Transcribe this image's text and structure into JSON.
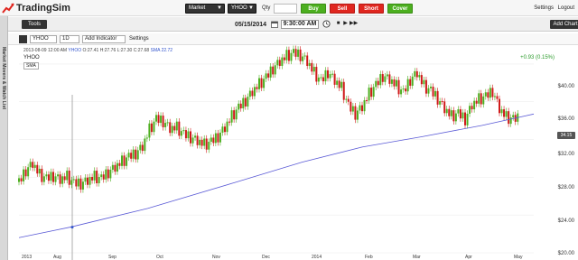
{
  "app": {
    "name": "TradingSim"
  },
  "header": {
    "order_type": "Market",
    "symbol": "YHOO",
    "qty_label": "Qty",
    "qty_value": "",
    "buy": "Buy",
    "sell": "Sell",
    "short": "Short",
    "cover": "Cover",
    "settings": "Settings",
    "logout": "Logout",
    "colors": {
      "buy": "#4caf1f",
      "sell": "#e0261f"
    }
  },
  "sidebar": {
    "label": "Market Movers & Watch List"
  },
  "subbar": {
    "tools": "Tools",
    "date": "05/15/2014",
    "time": "9:30:00 AM",
    "add_chart": "Add Chart"
  },
  "chart_toolbar": {
    "symbol": "YHOO",
    "interval": "1D",
    "add_indicator": "Add Indicator",
    "settings": "Settings"
  },
  "chart_data": {
    "type": "candlestick",
    "symbol": "YHOO",
    "ohlc_readout": {
      "date": "2013-08-09 12:00 AM",
      "symbol": "YHOO",
      "open": "27.41",
      "high": "27.76",
      "low": "27.30",
      "close": "27.68",
      "sma_label": "SMA",
      "sma_value": "22.72"
    },
    "sma_tag": "SMA",
    "change_text": "+0.93 (0.15%)",
    "last_price_tag": "34.15",
    "y_ticks": [
      "$40.00",
      "$36.00",
      "$32.00",
      "$28.00",
      "$24.00",
      "$20.00"
    ],
    "x_ticks": [
      "2013",
      "Aug",
      "Sep",
      "Oct",
      "Nov",
      "Dec",
      "2014",
      "Feb",
      "Mar",
      "Apr",
      "May"
    ],
    "ylim": [
      20,
      42
    ],
    "up_color": "#4caf1f",
    "down_color": "#d01a1a",
    "sma_color": "#5a5ad6",
    "close_path": [
      [
        0,
        27.5
      ],
      [
        8,
        28.6
      ],
      [
        16,
        29.4
      ],
      [
        24,
        28.2
      ],
      [
        32,
        27.9
      ],
      [
        40,
        28.0
      ],
      [
        48,
        27.7
      ],
      [
        56,
        28.0
      ],
      [
        64,
        27.4
      ],
      [
        72,
        27.2
      ],
      [
        80,
        27.6
      ],
      [
        88,
        28.0
      ],
      [
        96,
        27.9
      ],
      [
        104,
        28.4
      ],
      [
        112,
        29.0
      ],
      [
        120,
        29.6
      ],
      [
        128,
        30.2
      ],
      [
        136,
        30.4
      ],
      [
        144,
        31.2
      ],
      [
        152,
        33.0
      ],
      [
        160,
        34.2
      ],
      [
        168,
        33.8
      ],
      [
        176,
        33.1
      ],
      [
        184,
        33.2
      ],
      [
        192,
        32.6
      ],
      [
        200,
        32.1
      ],
      [
        208,
        31.8
      ],
      [
        216,
        31.4
      ],
      [
        224,
        31.8
      ],
      [
        232,
        32.2
      ],
      [
        240,
        33.2
      ],
      [
        248,
        34.4
      ],
      [
        256,
        35.4
      ],
      [
        264,
        36.0
      ],
      [
        272,
        37.0
      ],
      [
        280,
        37.8
      ],
      [
        288,
        38.6
      ],
      [
        296,
        39.4
      ],
      [
        304,
        40.2
      ],
      [
        312,
        40.8
      ],
      [
        320,
        41.2
      ],
      [
        328,
        40.8
      ],
      [
        336,
        40.2
      ],
      [
        344,
        39.0
      ],
      [
        352,
        38.2
      ],
      [
        360,
        39.0
      ],
      [
        368,
        38.2
      ],
      [
        376,
        37.4
      ],
      [
        384,
        35.6
      ],
      [
        392,
        34.6
      ],
      [
        400,
        35.4
      ],
      [
        408,
        36.8
      ],
      [
        416,
        37.8
      ],
      [
        424,
        38.6
      ],
      [
        432,
        38.3
      ],
      [
        440,
        37.6
      ],
      [
        448,
        37.0
      ],
      [
        456,
        38.2
      ],
      [
        464,
        39.0
      ],
      [
        472,
        37.6
      ],
      [
        480,
        37.2
      ],
      [
        488,
        36.2
      ],
      [
        496,
        35.2
      ],
      [
        504,
        34.4
      ],
      [
        512,
        34.8
      ],
      [
        520,
        34.0
      ],
      [
        528,
        35.6
      ],
      [
        536,
        36.2
      ],
      [
        544,
        36.6
      ],
      [
        552,
        37.0
      ],
      [
        560,
        35.2
      ],
      [
        568,
        34.3
      ],
      [
        576,
        34.2
      ],
      [
        584,
        34.15
      ]
    ],
    "sma_path": [
      [
        0,
        21.6
      ],
      [
        60,
        22.72
      ],
      [
        150,
        24.7
      ],
      [
        250,
        27.4
      ],
      [
        330,
        29.6
      ],
      [
        400,
        31.2
      ],
      [
        470,
        32.3
      ],
      [
        540,
        33.5
      ],
      [
        600,
        34.7
      ]
    ]
  }
}
